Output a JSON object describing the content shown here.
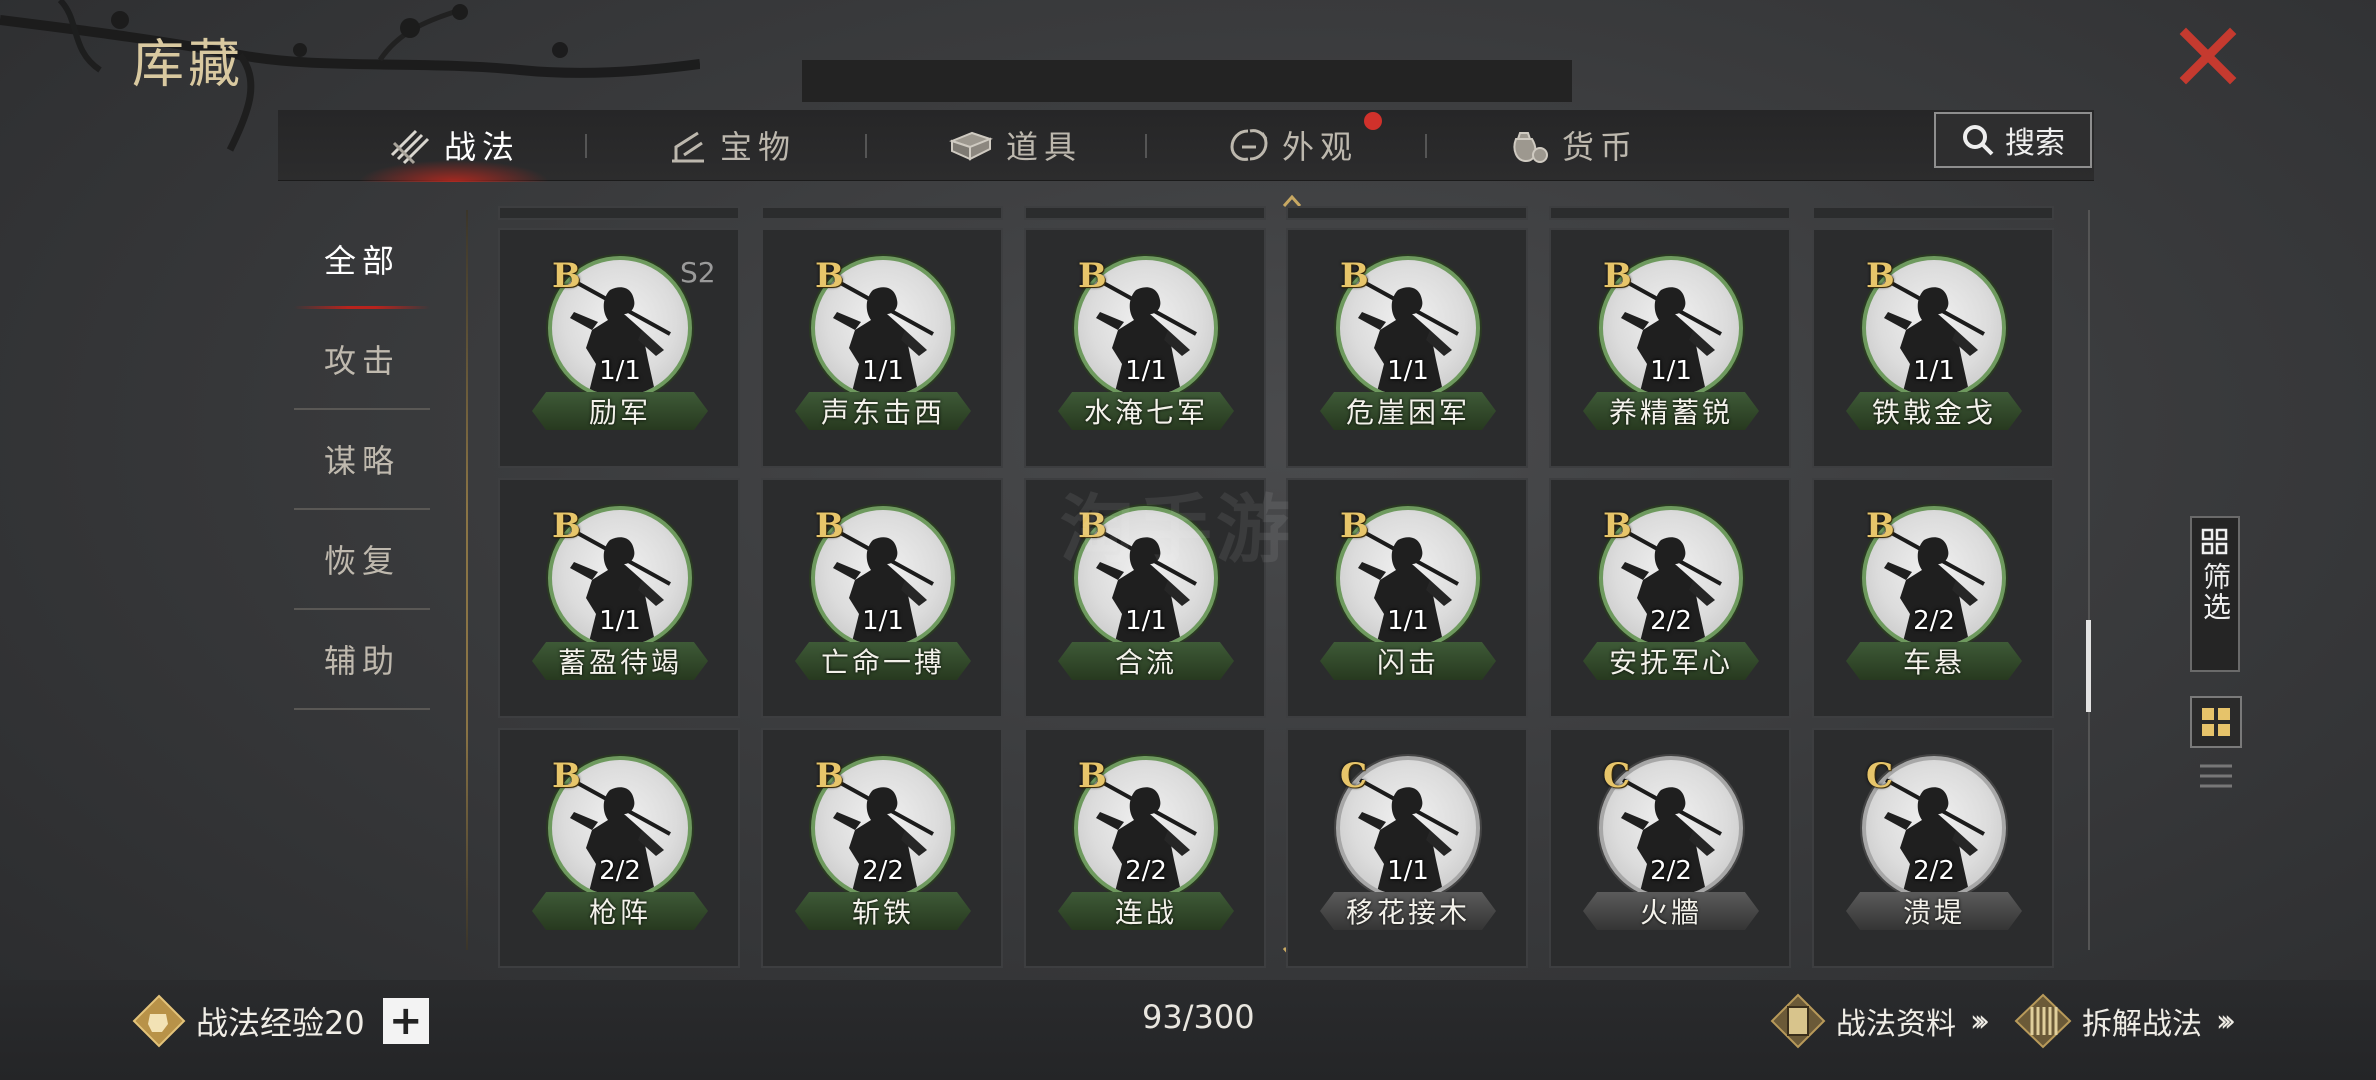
{
  "header": {
    "title": "库藏",
    "close_icon": "close-x-icon",
    "accent": "#c53a2f"
  },
  "tabs": [
    {
      "label": "战法",
      "icon": "tactics-icon",
      "active": true
    },
    {
      "label": "宝物",
      "icon": "treasure-icon",
      "active": false
    },
    {
      "label": "道具",
      "icon": "items-icon",
      "active": false
    },
    {
      "label": "外观",
      "icon": "appearance-icon",
      "active": false,
      "badge": true
    },
    {
      "label": "货币",
      "icon": "currency-icon",
      "active": false
    }
  ],
  "search": {
    "label": "搜索",
    "icon": "search-icon"
  },
  "categories": [
    {
      "label": "全部",
      "active": true
    },
    {
      "label": "攻击",
      "active": false
    },
    {
      "label": "谋略",
      "active": false
    },
    {
      "label": "恢复",
      "active": false
    },
    {
      "label": "辅助",
      "active": false
    }
  ],
  "tactics": [
    {
      "name": "励军",
      "grade": "B",
      "uses": "1/1",
      "season": "S2"
    },
    {
      "name": "声东击西",
      "grade": "B",
      "uses": "1/1"
    },
    {
      "name": "水淹七军",
      "grade": "B",
      "uses": "1/1"
    },
    {
      "name": "危崖困军",
      "grade": "B",
      "uses": "1/1"
    },
    {
      "name": "养精蓄锐",
      "grade": "B",
      "uses": "1/1"
    },
    {
      "name": "铁戟金戈",
      "grade": "B",
      "uses": "1/1"
    },
    {
      "name": "蓄盈待竭",
      "grade": "B",
      "uses": "1/1"
    },
    {
      "name": "亡命一搏",
      "grade": "B",
      "uses": "1/1"
    },
    {
      "name": "合流",
      "grade": "B",
      "uses": "1/1"
    },
    {
      "name": "闪击",
      "grade": "B",
      "uses": "1/1"
    },
    {
      "name": "安抚军心",
      "grade": "B",
      "uses": "2/2"
    },
    {
      "name": "车悬",
      "grade": "B",
      "uses": "2/2"
    },
    {
      "name": "枪阵",
      "grade": "B",
      "uses": "2/2"
    },
    {
      "name": "斩铁",
      "grade": "B",
      "uses": "2/2"
    },
    {
      "name": "连战",
      "grade": "B",
      "uses": "2/2"
    },
    {
      "name": "移花接木",
      "grade": "C",
      "uses": "1/1"
    },
    {
      "name": "火牆",
      "grade": "C",
      "uses": "2/2"
    },
    {
      "name": "溃堤",
      "grade": "C",
      "uses": "2/2"
    }
  ],
  "side": {
    "filter_label": "筛选",
    "filter_icon": "filter-grid-icon",
    "grid_view_icon": "grid-view-icon",
    "list_view_icon": "list-view-icon"
  },
  "footer": {
    "exp_label": "战法经验20",
    "exp_icon": "fist-badge-icon",
    "plus_label": "+",
    "count": "93/300",
    "info_link": "战法资料",
    "disassemble_link": "拆解战法"
  },
  "colors": {
    "grade_b_ring": "#6e9a5e",
    "grade_c_ring": "#a7a7a7",
    "grade_text": "#e7c56a"
  }
}
